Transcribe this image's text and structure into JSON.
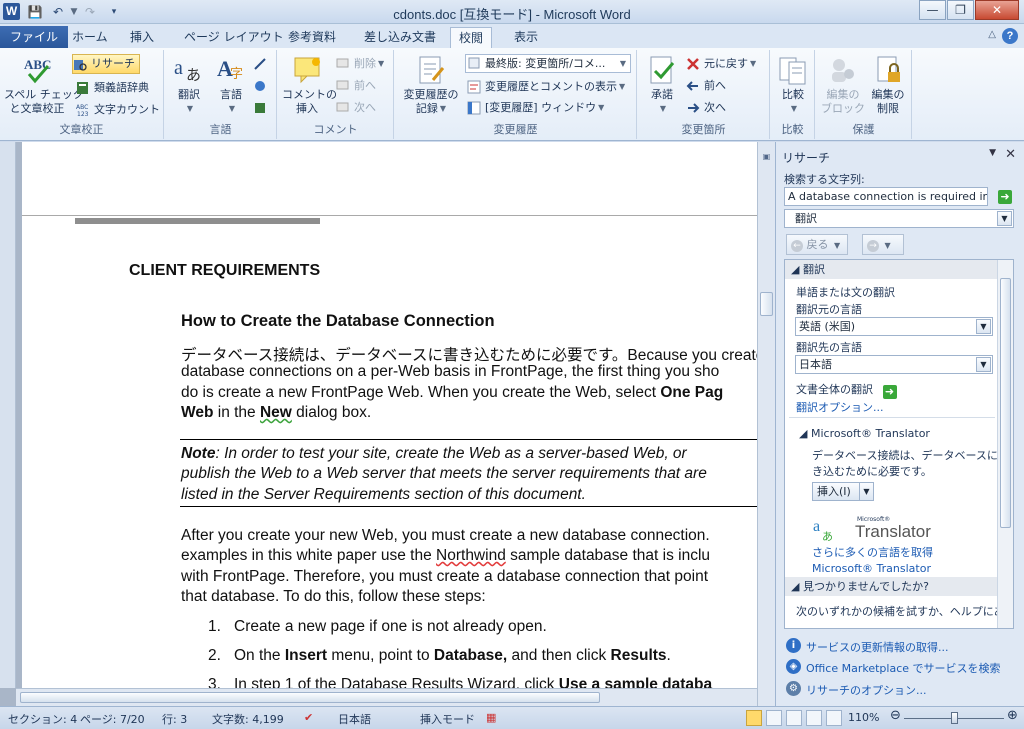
{
  "window": {
    "title": "cdonts.doc [互換モード] - Microsoft Word",
    "app_icon": "W"
  },
  "tabs": [
    {
      "label": "ファイル"
    },
    {
      "label": "ホーム"
    },
    {
      "label": "挿入"
    },
    {
      "label": "ページ レイアウト"
    },
    {
      "label": "参考資料"
    },
    {
      "label": "差し込み文書"
    },
    {
      "label": "校閲"
    },
    {
      "label": "表示"
    }
  ],
  "ribbon": {
    "proofing": {
      "label": "文章校正",
      "spelling": "スペル チェック\nと文章校正",
      "research": "リサーチ",
      "thesaurus": "類義語辞典",
      "wordcount": "文字カウント"
    },
    "language": {
      "label": "言語",
      "translate": "翻訳",
      "language": "言語"
    },
    "comments": {
      "label": "コメント",
      "new_comment": "コメントの\n挿入",
      "delete": "削除",
      "prev": "前へ",
      "next": "次へ"
    },
    "tracking": {
      "label": "変更履歴",
      "track_changes": "変更履歴の\n記録",
      "display_for_review": "最終版: 変更箇所/コメ...",
      "show_markup": "変更履歴とコメントの表示",
      "reviewing_pane": "[変更履歴] ウィンドウ"
    },
    "changes": {
      "label": "変更箇所",
      "accept": "承諾",
      "reject": "元に戻す",
      "prev": "前へ",
      "next": "次へ"
    },
    "compare": {
      "label": "比較",
      "compare": "比較"
    },
    "protect": {
      "label": "保護",
      "block_authors": "編集の\nブロック",
      "restrict_editing": "編集の\n制限"
    }
  },
  "document": {
    "heading1": "CLIENT REQUIREMENTS",
    "heading2": "How to Create the Database Connection",
    "p1_line1": "データベース接続は、データベースに書き込むために必要です。Because you create",
    "p1_line2": "database connections on a per-Web basis in FrontPage, the first thing you sho",
    "p1_line3_a": "do is create a new FrontPage Web. When you create the Web, select ",
    "p1_line3_b": "One Pag",
    "p1_line4_a": "Web",
    "p1_line4_b": " in the ",
    "p1_line4_c": "New",
    "p1_line4_d": " dialog box.",
    "note_label": "Note",
    "note_line1": ": In order to test your site, create the Web as a server-based Web, or",
    "note_line2": "publish the Web to a Web server that meets the server requirements that are",
    "note_line3": "listed in the Server Requirements section of this document.",
    "p2_line1": "After you create your new Web, you must create a  new database connection.",
    "p2_line2_a": "examples in this white paper use the ",
    "p2_line2_b": "Northwind",
    "p2_line2_c": " sample database that is inclu",
    "p2_line3": "with FrontPage. Therefore, you must create a database connection that point",
    "p2_line4": "that database. To do this, follow these steps:",
    "steps": [
      {
        "num": "1.",
        "text": "Create a new page if one is not already open."
      },
      {
        "num": "2.",
        "a": "On the ",
        "b": "Insert",
        "c": " menu, point to ",
        "d": "Database,",
        "e": " and then click ",
        "f": "Results",
        "g": "."
      },
      {
        "num": "3.",
        "a": "In step 1 of the Database Results Wizard, click ",
        "b": "Use a sample databa"
      }
    ]
  },
  "research_pane": {
    "title": "リサーチ",
    "search_label": "検索する文字列:",
    "search_value": "A database connection is required in o",
    "service": "翻訳",
    "back": "戻る",
    "section_translate": "翻訳",
    "word_translation": "単語または文の翻訳",
    "from_label": "翻訳元の言語",
    "from_value": "英語 (米国)",
    "to_label": "翻訳先の言語",
    "to_value": "日本語",
    "translate_doc": "文書全体の翻訳",
    "translate_options": "翻訳オプション...",
    "ms_translator": "Microsoft® Translator",
    "result_line1": "データベース接続は、データベースに書",
    "result_line2": "き込むために必要です。",
    "insert_btn": "挿入(I)",
    "brand_small": "Microsoft®",
    "brand_big": "Translator",
    "more_langs": "さらに多くの言語を取得",
    "ms_translator_link": "Microsoft® Translator",
    "not_found": "見つかりませんでしたか?",
    "not_found_text": "次のいずれかの候補を試すか、ヘルプにあ",
    "link_updates": "サービスの更新情報の取得...",
    "link_marketplace": "Office Marketplace でサービスを検索",
    "link_options": "リサーチのオプション..."
  },
  "status": {
    "section": "セクション: 4",
    "page": "ページ: 7/20",
    "line": "行: 3",
    "words": "文字数: 4,199",
    "language": "日本語",
    "mode": "挿入モード",
    "zoom": "110%"
  }
}
